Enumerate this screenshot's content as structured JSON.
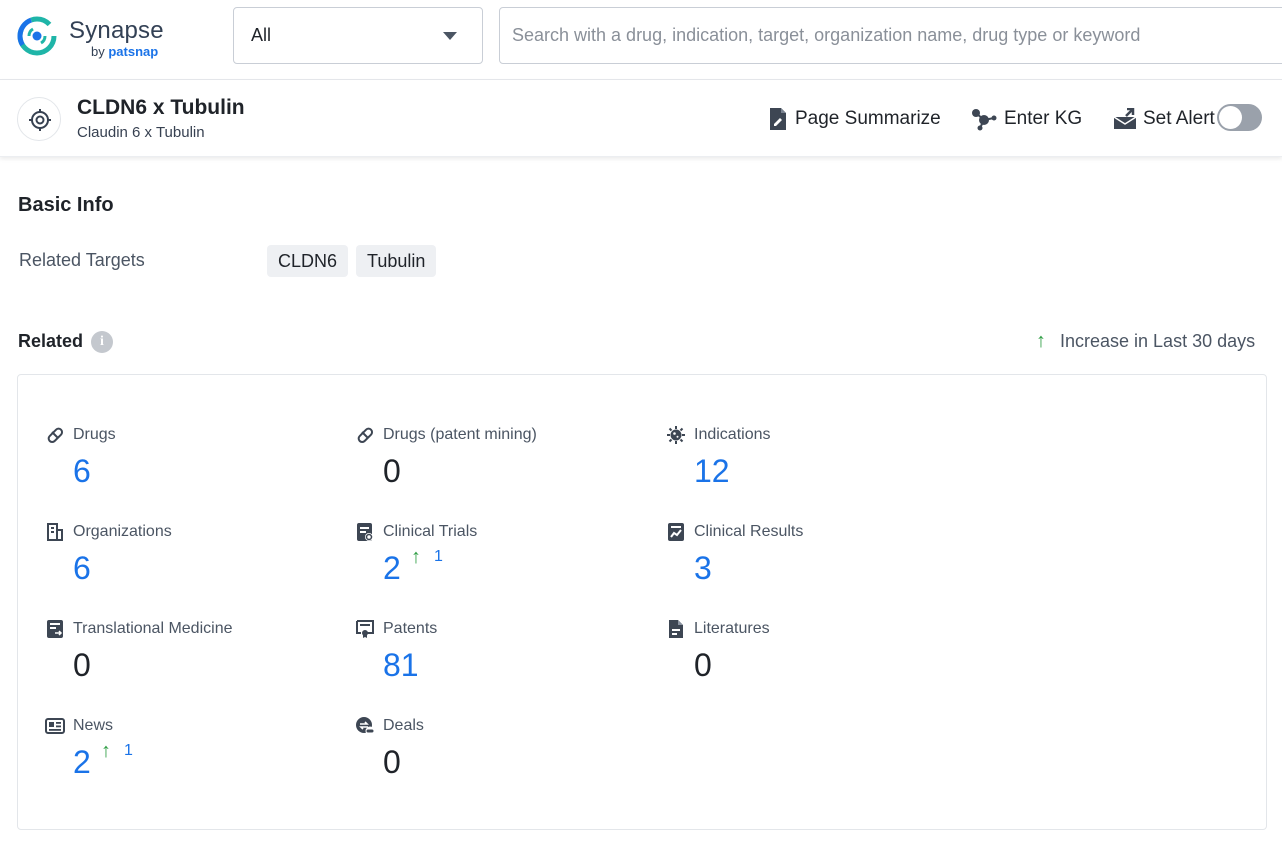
{
  "brand": {
    "name": "Synapse",
    "by_prefix": "by ",
    "by_name": "patsnap"
  },
  "search": {
    "scope_value": "All",
    "placeholder": "Search with a drug, indication, target, organization name, drug type or keyword"
  },
  "entity": {
    "title": "CLDN6 x Tubulin",
    "subtitle": "Claudin 6 x Tubulin",
    "actions": {
      "summarize": "Page Summarize",
      "kg": "Enter KG",
      "alert": "Set Alert"
    },
    "alert_enabled": false
  },
  "basic_info": {
    "title": "Basic Info",
    "related_targets_label": "Related Targets",
    "targets": [
      "CLDN6",
      "Tubulin"
    ]
  },
  "related": {
    "title": "Related",
    "legend": "Increase in Last 30 days",
    "stats": [
      {
        "label": "Drugs",
        "value": "6",
        "icon": "pill-icon",
        "link": true
      },
      {
        "label": "Drugs (patent mining)",
        "value": "0",
        "icon": "pill-icon",
        "link": false
      },
      {
        "label": "Indications",
        "value": "12",
        "icon": "virus-icon",
        "link": true
      },
      {
        "label": "Organizations",
        "value": "6",
        "icon": "building-icon",
        "link": true
      },
      {
        "label": "Clinical Trials",
        "value": "2",
        "increase": "1",
        "icon": "clinical-trials-icon",
        "link": true
      },
      {
        "label": "Clinical Results",
        "value": "3",
        "icon": "clinical-results-icon",
        "link": true
      },
      {
        "label": "Translational Medicine",
        "value": "0",
        "icon": "translational-medicine-icon",
        "link": false
      },
      {
        "label": "Patents",
        "value": "81",
        "icon": "patent-icon",
        "link": true
      },
      {
        "label": "Literatures",
        "value": "0",
        "icon": "literature-icon",
        "link": false
      },
      {
        "label": "News",
        "value": "2",
        "increase": "1",
        "icon": "news-icon",
        "link": true
      },
      {
        "label": "Deals",
        "value": "0",
        "icon": "deals-icon",
        "link": false
      }
    ]
  },
  "colors": {
    "link": "#1a73e8",
    "increase": "#2f9e44",
    "brand_teal": "#1fb5a8",
    "brand_blue": "#1a73e8"
  }
}
